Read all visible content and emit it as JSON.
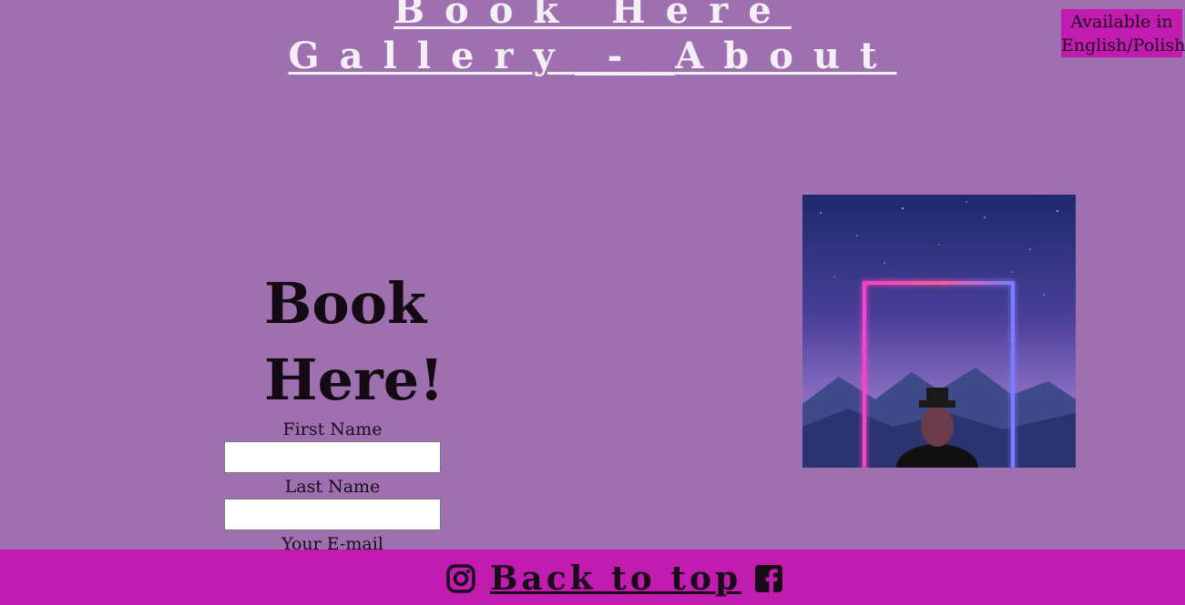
{
  "nav": {
    "book": "Book Here",
    "gallery": "Gallery",
    "separator": "-",
    "about": "About"
  },
  "language_badge": {
    "line1": "Available in",
    "line2": "English/Polish"
  },
  "booking": {
    "title_line1": "Book",
    "title_line2": "Here!",
    "first_name_label": "First Name",
    "first_name_value": "",
    "last_name_label": "Last Name",
    "last_name_value": "",
    "email_label": "Your E-mail"
  },
  "photo": {
    "icon": "neon-portal-image"
  },
  "footer": {
    "back_to_top": "Back to top",
    "left_icon": "instagram-icon",
    "right_icon": "facebook-icon"
  },
  "colors": {
    "background": "#9f70b0",
    "accent": "#c21bb0",
    "nav_text": "#f4eef6"
  }
}
